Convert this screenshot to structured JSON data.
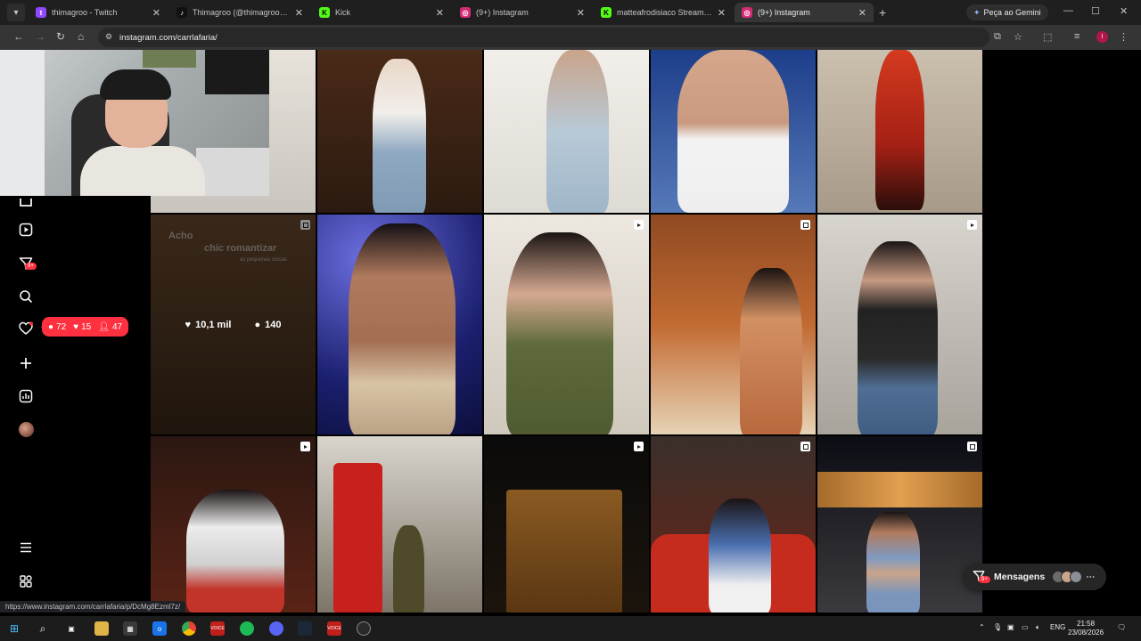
{
  "browser": {
    "tabs": [
      {
        "title": "thimagroo - Twitch",
        "icon": "twitch-icon",
        "color": "#9146ff"
      },
      {
        "title": "Thimagroo (@thimagroo) | TikTok",
        "icon": "tiktok-icon",
        "color": "#111111"
      },
      {
        "title": "Kick",
        "icon": "kick-icon",
        "color": "#53fc18"
      },
      {
        "title": "(9+) Instagram",
        "icon": "instagram-icon",
        "color": "#d62976"
      },
      {
        "title": "matteafrodisiaco Stream - Watch",
        "icon": "kick-icon",
        "color": "#53fc18"
      },
      {
        "title": "(9+) Instagram",
        "icon": "instagram-icon",
        "color": "#d62976"
      }
    ],
    "gemini_label": "Peça ao Gemini",
    "url": "instagram.com/carrlafaria/",
    "profile_initial": "I",
    "status_url": "https://www.instagram.com/carrlafaria/p/DcMg8Ezml7z/"
  },
  "instagram": {
    "nav_badge": "9+",
    "notifications": {
      "comments": "72",
      "likes": "15",
      "follows": "47"
    },
    "hover_post": {
      "likes": "10,1 mil",
      "comments": "140",
      "overlay_line1": "Acho",
      "overlay_line2": "chic romantizar",
      "overlay_line3": "as pequenas coisas"
    },
    "messages": {
      "label": "Mensagens",
      "badge": "9+"
    }
  },
  "taskbar": {
    "language": "ENG",
    "time": "21:58",
    "date": "23/08/2026",
    "voice_label": "VOICE"
  },
  "colors": {
    "accent_red": "#ff3040",
    "chrome_bg": "#1f1f1f",
    "toolbar_bg": "#353535"
  }
}
